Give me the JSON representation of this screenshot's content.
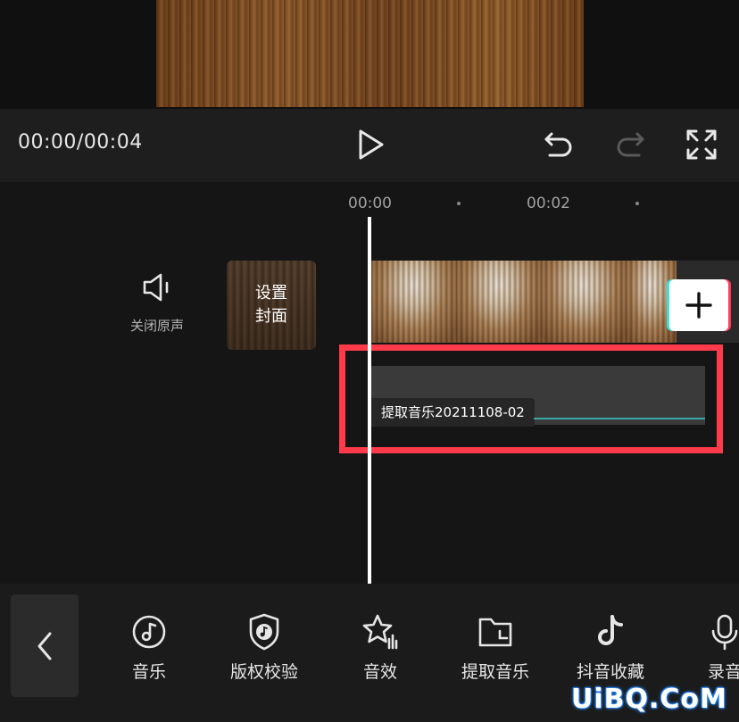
{
  "player": {
    "timecode": "00:00/00:04"
  },
  "timeline": {
    "ruler": [
      "00:00",
      "00:02"
    ],
    "mute_label": "关闭原声",
    "cover_label": "设置\n封面",
    "audio_clip_label": "提取音乐20211108-02"
  },
  "toolbar": {
    "items": [
      {
        "label": "音乐",
        "icon": "music-note-circle-icon"
      },
      {
        "label": "版权校验",
        "icon": "shield-music-icon"
      },
      {
        "label": "音效",
        "icon": "star-bars-icon"
      },
      {
        "label": "提取音乐",
        "icon": "folder-icon"
      },
      {
        "label": "抖音收藏",
        "icon": "tiktok-note-icon"
      },
      {
        "label": "录音",
        "icon": "microphone-icon"
      }
    ]
  },
  "watermark": "UiBQ.CoM",
  "colors": {
    "highlight": "#ff3a4a",
    "background": "#171717",
    "accent_cyan": "#3fe0d8",
    "accent_red": "#ff3b5c"
  }
}
